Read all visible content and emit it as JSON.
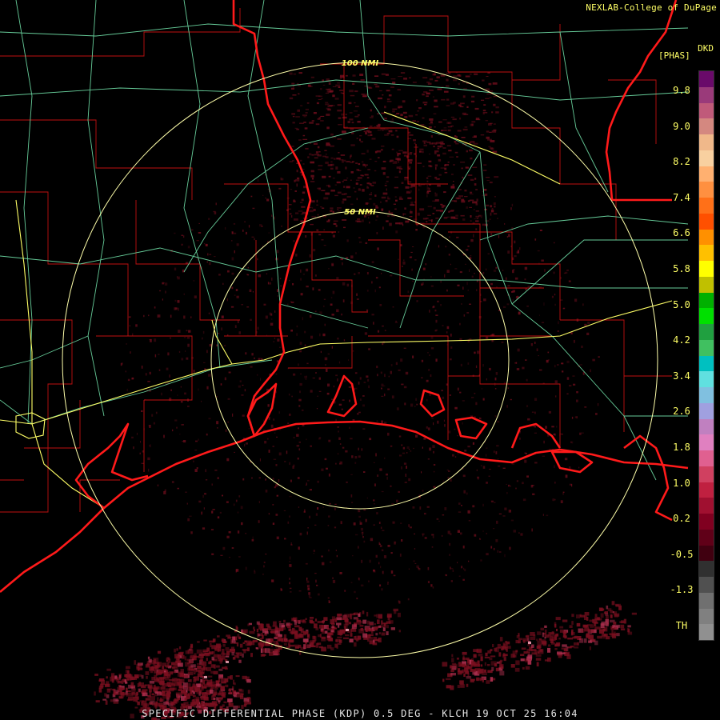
{
  "header": {
    "credit": "NEXLAB-College of DuPage",
    "product_code": "DKD",
    "product_unit": "[PHAS]"
  },
  "footer": {
    "caption": "SPECIFIC DIFFERENTIAL PHASE (KDP) 0.5 DEG - KLCH 19 OCT 25 16:04"
  },
  "range_rings": [
    {
      "label": "100 NMI"
    },
    {
      "label": "50 NMI"
    }
  ],
  "colors": {
    "background": "#000000",
    "state_border": "#ff1a1a",
    "county_border": "#c01010",
    "interstate": "#ffff66",
    "highway": "#66cc99",
    "range_ring": "#ffffaa",
    "echo": "#7a0f1f",
    "label_text": "#ffff66"
  },
  "color_scale": {
    "labels": [
      "9.8",
      "9.0",
      "8.2",
      "7.4",
      "6.6",
      "5.8",
      "5.0",
      "4.2",
      "3.4",
      "2.6",
      "1.8",
      "1.0",
      "0.2",
      "-0.5",
      "-1.3",
      "TH"
    ],
    "colors": [
      "#6a0a6a",
      "#9a3a7a",
      "#c05a7a",
      "#d48880",
      "#f0b88a",
      "#f8d0a0",
      "#ffb070",
      "#ff9040",
      "#ff7018",
      "#ff5000",
      "#ff9000",
      "#ffc000",
      "#ffff00",
      "#c0c000",
      "#00b000",
      "#00e000",
      "#20a040",
      "#40c060",
      "#00c0c0",
      "#60e0e0",
      "#80c0e0",
      "#a0a0e0",
      "#c080c0",
      "#e080c0",
      "#e06090",
      "#d04060",
      "#c02040",
      "#a01030",
      "#800020",
      "#600018",
      "#400010",
      "#303030",
      "#505050",
      "#707070",
      "#808080",
      "#909090"
    ]
  }
}
